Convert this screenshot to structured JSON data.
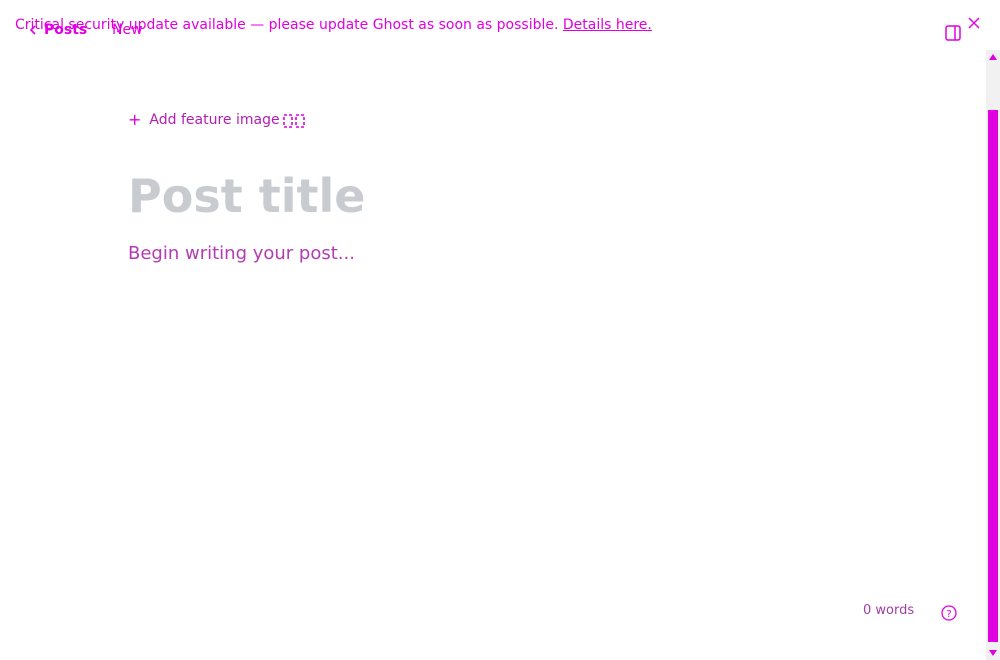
{
  "banner": {
    "message": "Critical security update available — please update Ghost as soon as possible.",
    "link_text": "Details here."
  },
  "header": {
    "back_label": "Posts",
    "status": "New"
  },
  "editor": {
    "feature_image_label": "Add feature image",
    "title_placeholder": "Post title",
    "body_placeholder": "Begin writing your post..."
  },
  "footer": {
    "word_count": "0 words"
  },
  "icons": {
    "back": "chevron-left-icon",
    "close": "close-icon",
    "sidebar": "sidebar-toggle-icon",
    "image": "image-icon",
    "help": "help-icon"
  },
  "colors": {
    "accent": "#e000e0",
    "title_placeholder": "#c8cbd0"
  }
}
